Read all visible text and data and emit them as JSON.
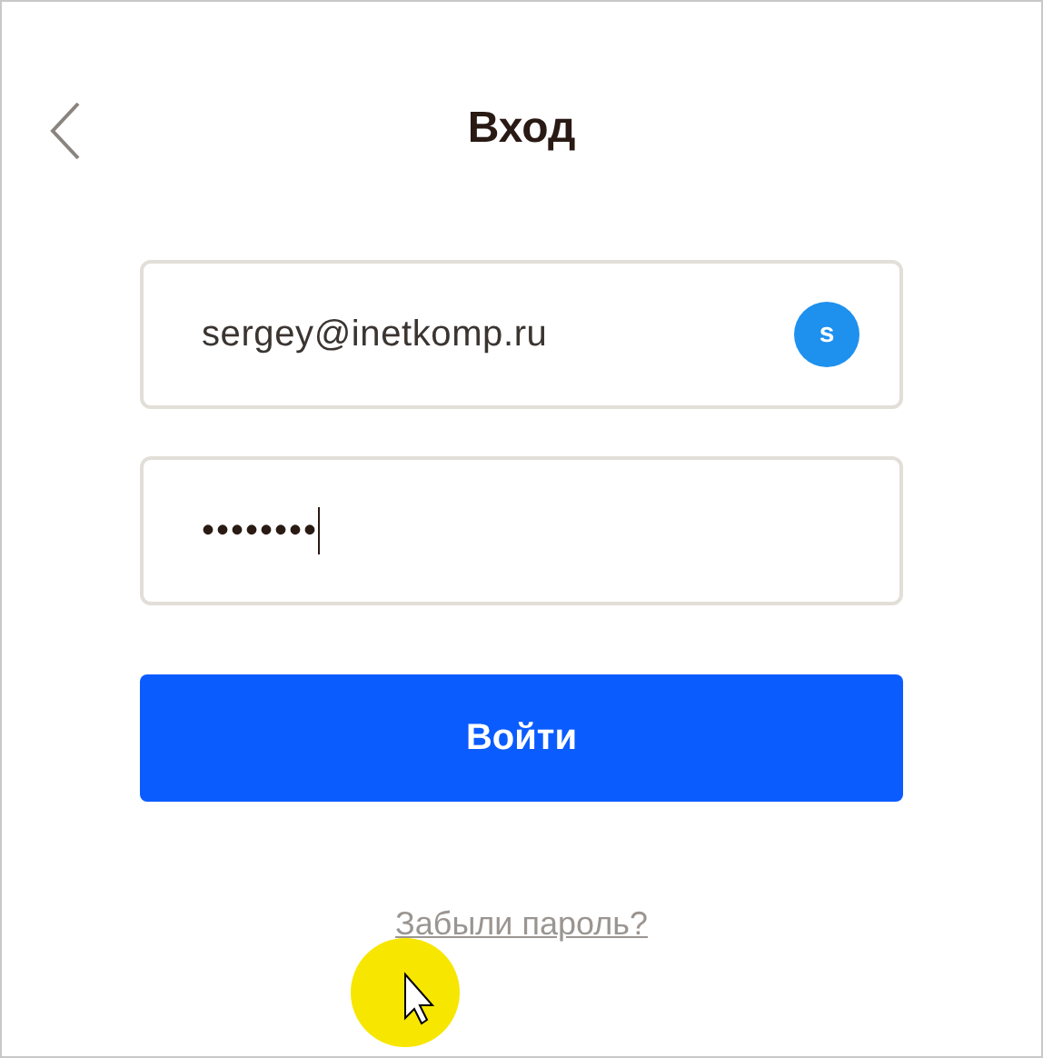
{
  "header": {
    "title": "Вход"
  },
  "email_field": {
    "value": "sergey@inetkomp.ru",
    "avatar_letter": "s"
  },
  "password_field": {
    "value": "••••••••"
  },
  "login_button": {
    "label": "Войти"
  },
  "forgot_link": {
    "label": "Забыли пароль?"
  }
}
